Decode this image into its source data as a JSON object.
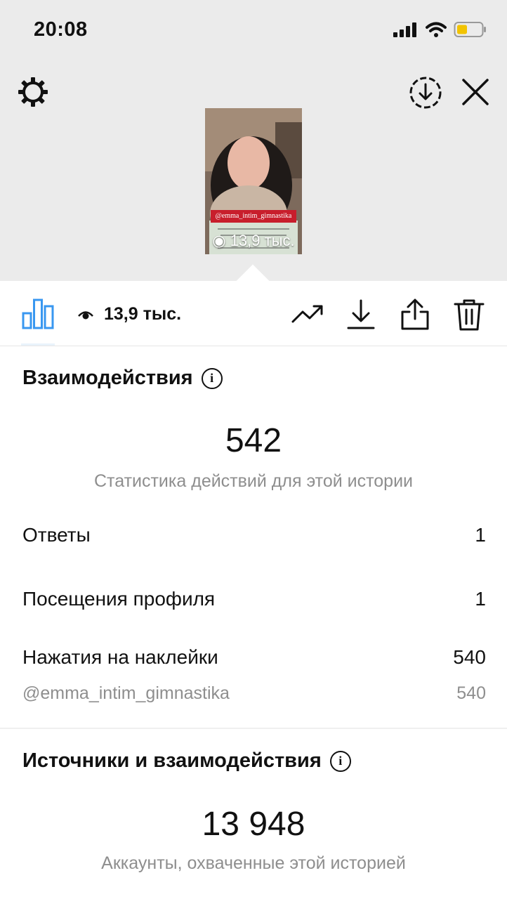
{
  "status_bar": {
    "time": "20:08"
  },
  "story": {
    "views_overlay": "13,9 тыс.",
    "mention_tag": "@emma_intim_gimnastika"
  },
  "toolbar": {
    "views": "13,9 тыс."
  },
  "interactions": {
    "title": "Взаимодействия",
    "total": "542",
    "subtitle": "Статистика действий для этой истории",
    "rows": [
      {
        "label": "Ответы",
        "value": "1"
      },
      {
        "label": "Посещения профиля",
        "value": "1"
      },
      {
        "label": "Нажатия на наклейки",
        "value": "540"
      }
    ],
    "sticker_detail": {
      "label": "@emma_intim_gimnastika",
      "value": "540"
    }
  },
  "discovery": {
    "title": "Источники и взаимодействия",
    "total": "13 948",
    "subtitle": "Аккаунты, охваченные этой историей"
  },
  "colors": {
    "accent": "#3897f0",
    "muted": "#8e8e8e",
    "header_bg": "#ebebeb"
  },
  "icons": [
    "gear-icon",
    "download-circle-icon",
    "close-icon",
    "insights-bars-icon",
    "eye-icon",
    "trend-icon",
    "download-icon",
    "share-icon",
    "trash-icon",
    "info-icon",
    "signal-icon",
    "wifi-icon",
    "battery-icon"
  ]
}
